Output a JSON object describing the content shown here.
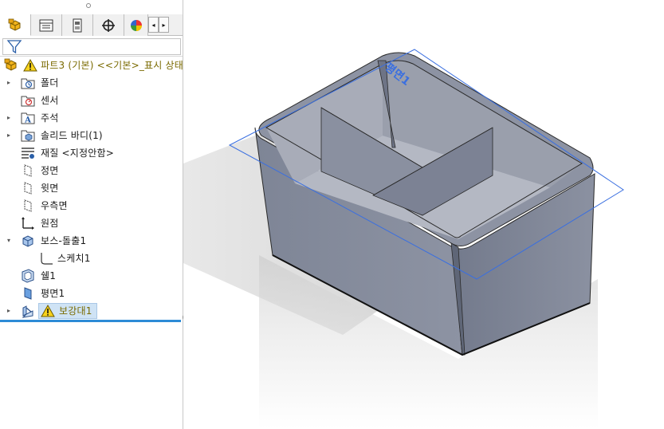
{
  "tabs": [
    {
      "name": "feature-manager"
    },
    {
      "name": "property-manager"
    },
    {
      "name": "configuration-manager"
    },
    {
      "name": "dimxpert-manager"
    },
    {
      "name": "display-manager"
    }
  ],
  "tab_arrows": {
    "left": "◂",
    "right": "▸"
  },
  "tree": {
    "root": {
      "label": "파트3 (기본) <<기본>_표시 상태",
      "warning": true
    },
    "items": [
      {
        "label": "폴더",
        "icon": "history-folder-icon",
        "expandable": true
      },
      {
        "label": "센서",
        "icon": "sensor-icon",
        "expandable": false
      },
      {
        "label": "주석",
        "icon": "annotation-icon",
        "expandable": true
      },
      {
        "label": "솔리드 바디(1)",
        "icon": "solid-bodies-icon",
        "expandable": true
      },
      {
        "label": "재질 <지정안함>",
        "icon": "material-icon",
        "expandable": false
      },
      {
        "label": "정면",
        "icon": "plane-icon",
        "expandable": false
      },
      {
        "label": "윗면",
        "icon": "plane-icon",
        "expandable": false
      },
      {
        "label": "우측면",
        "icon": "plane-icon",
        "expandable": false
      },
      {
        "label": "원점",
        "icon": "origin-icon",
        "expandable": false
      },
      {
        "label": "보스-돌출1",
        "icon": "boss-extrude-icon",
        "expandable": true,
        "expanded": true
      },
      {
        "label": "스케치1",
        "icon": "sketch-icon",
        "expandable": false,
        "child": true
      },
      {
        "label": "쉘1",
        "icon": "shell-icon",
        "expandable": false
      },
      {
        "label": "평면1",
        "icon": "plane1-icon",
        "expandable": false
      },
      {
        "label": "보강대1",
        "icon": "rib-icon",
        "expandable": true,
        "warning": true,
        "selected": true
      }
    ]
  },
  "viewport": {
    "plane_label": "평면1",
    "colors": {
      "body": "#8e94a4",
      "edge": "#2a2a2a",
      "plane": "#3a6fe0",
      "shadow": "#dcdcdc"
    }
  }
}
